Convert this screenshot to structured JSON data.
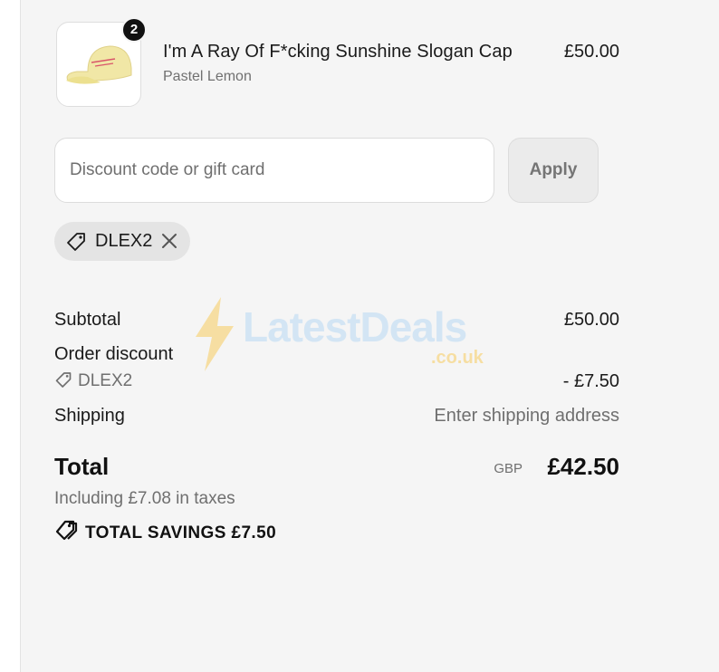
{
  "product": {
    "title": "I'm A Ray Of F*cking Sunshine Slogan Cap",
    "variant": "Pastel Lemon",
    "price": "£50.00",
    "quantity": "2",
    "image_icon": "cap-image"
  },
  "discount": {
    "placeholder": "Discount code or gift card",
    "value": "",
    "apply_label": "Apply",
    "applied_code": "DLEX2"
  },
  "summary": {
    "subtotal_label": "Subtotal",
    "subtotal_value": "£50.00",
    "order_discount_label": "Order discount",
    "discount_code": "DLEX2",
    "discount_value": "- £7.50",
    "shipping_label": "Shipping",
    "shipping_value": "Enter shipping address",
    "total_label": "Total",
    "currency": "GBP",
    "total_value": "£42.50",
    "taxes_note": "Including £7.08 in taxes",
    "savings_label": "TOTAL SAVINGS £7.50"
  },
  "watermark": {
    "text": "LatestDeals",
    "subtext": ".co.uk"
  },
  "colors": {
    "panel_bg": "#f5f5f5",
    "text": "#1a1a1a",
    "muted": "#6f6f6f",
    "chip_bg": "#e4e4e4",
    "cap_yellow": "#f1e7a6"
  }
}
